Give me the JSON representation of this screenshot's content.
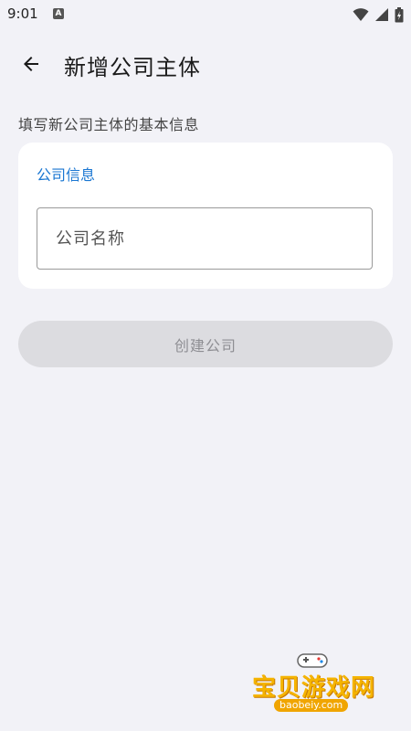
{
  "status_bar": {
    "time": "9:01",
    "notification_icon": "a-icon",
    "icons": [
      "wifi-icon",
      "signal-icon",
      "battery-icon"
    ]
  },
  "app_bar": {
    "back_icon": "arrow-left-icon",
    "title": "新增公司主体"
  },
  "form": {
    "subtitle": "填写新公司主体的基本信息",
    "card_title": "公司信息",
    "company_name": {
      "value": "",
      "placeholder": "公司名称"
    },
    "submit_label": "创建公司"
  },
  "colors": {
    "background": "#f2f2f7",
    "card": "#ffffff",
    "accent": "#1976d2",
    "button_disabled_bg": "#dcdce0",
    "button_disabled_text": "#8e8e93"
  },
  "watermark": {
    "text": "宝贝游戏网",
    "url": "baobeiy.com"
  }
}
